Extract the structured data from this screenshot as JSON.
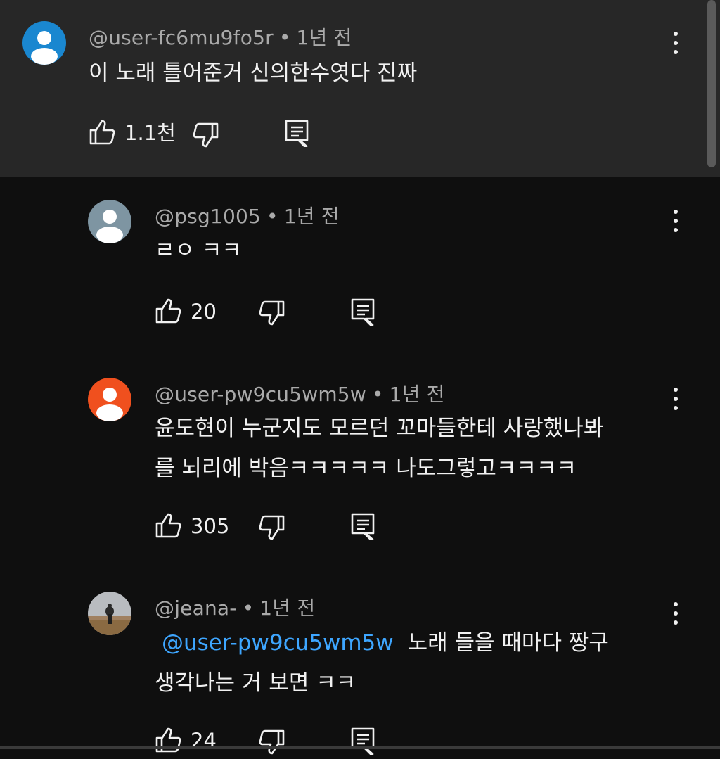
{
  "colors": {
    "background": "#0f0f0f",
    "highlight_background": "#272727",
    "text": "#f1f1f1",
    "meta_text": "#aaaaaa",
    "mention": "#3ea6ff"
  },
  "comments": [
    {
      "handle": "@user-fc6mu9fo5r",
      "time": "1년 전",
      "avatar_color": "#1a87d0",
      "lines": [
        "이 노래 틀어준거 신의한수엿다 진짜"
      ],
      "likes": "1.1천"
    },
    {
      "handle": "@psg1005",
      "time": "1년 전",
      "avatar_color": "#7e95a2",
      "lines": [
        "ㄹㅇ ㅋㅋ"
      ],
      "likes": "20"
    },
    {
      "handle": "@user-pw9cu5wm5w",
      "time": "1년 전",
      "avatar_color": "#f0501e",
      "lines": [
        "윤도현이 누군지도 모르던 꼬마들한테 사랑했나봐",
        "를 뇌리에 박음ㅋㅋㅋㅋㅋ 나도그렇고ㅋㅋㅋㅋ"
      ],
      "likes": "305"
    },
    {
      "handle": "@jeana-",
      "time": "1년 전",
      "avatar_color": "#9a8a6a",
      "mention": "@user-pw9cu5wm5w",
      "lines": [
        "노래 들을 때마다 짱구",
        "생각나는 거 보면 ㅋㅋ"
      ],
      "likes": "24"
    }
  ],
  "icons": {
    "like": "thumbs-up-icon",
    "dislike": "thumbs-down-icon",
    "reply": "reply-comment-icon",
    "more": "more-vertical-icon"
  },
  "separator": "•"
}
